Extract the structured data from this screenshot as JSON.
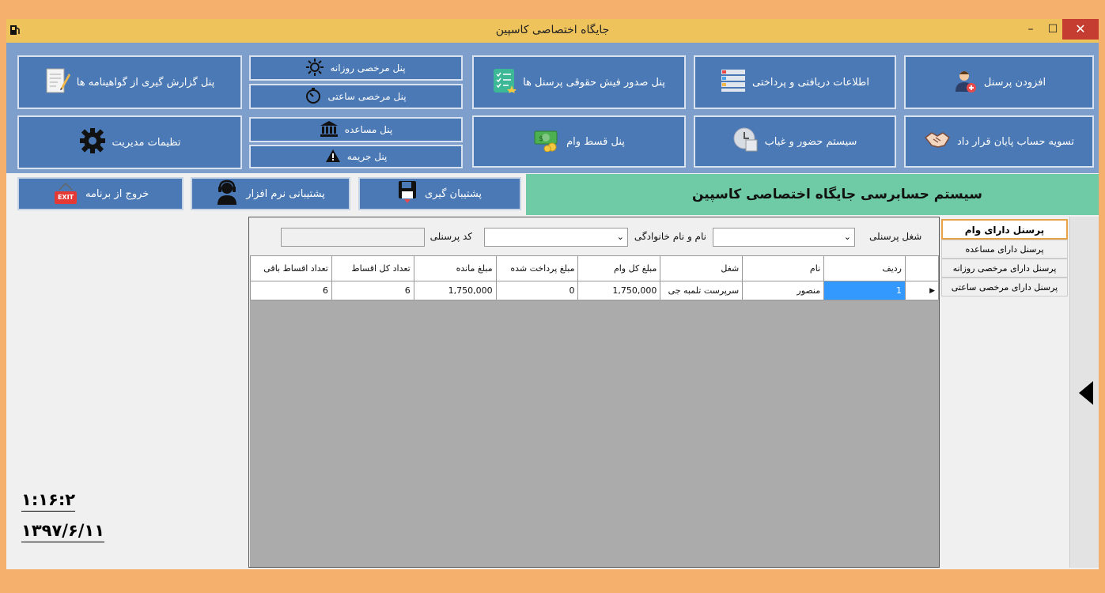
{
  "window": {
    "title": "جایگاه اختصاصی کاسپین",
    "minimize": "–",
    "maximize": "☐",
    "close": "✕"
  },
  "tiles": {
    "add_personnel": "افزودن پرسنل",
    "payments_info": "اطلاعات دریافتی و پرداختی",
    "payslip_panel": "پنل صدور فیش حقوقی پرسنل ها",
    "daily_leave": "پنل مرخصی روزانه",
    "hourly_leave": "پنل مرخصی ساعتی",
    "certificate_report": "پنل گزارش گیری از گواهینامه ها",
    "contract_settlement": "تسویه حساب پایان قرار داد",
    "attendance": "سیستم حضور و غیاب",
    "loan_installment": "پنل قسط وام",
    "assistance": "پنل مساعده",
    "penalty": "پنل جریمه",
    "admin_settings": "تظیمات مدیریت"
  },
  "banner": {
    "title": "سیستم حسابرسی جایگاه اختصاصی کاسپین"
  },
  "actions": {
    "backup": "پشتیبان گیری",
    "support": "پشتیبانی نرم افزار",
    "exit": "خروج از برنامه",
    "exit_badge": "EXIT"
  },
  "clock": {
    "time": "۱:۱۶:۲",
    "date": "۱۳۹۷/۶/۱۱"
  },
  "filters": {
    "job_label": "شغل پرسنلی",
    "name_label": "نام و نام خانوادگی",
    "code_label": "کد پرسنلی",
    "job_value": "",
    "name_value": "",
    "code_value": ""
  },
  "table": {
    "headers": {
      "row": "ردیف",
      "name": "نام",
      "job": "شغل",
      "total_loan": "مبلغ کل وام",
      "paid": "مبلغ پرداخت شده",
      "remaining": "مبلغ مانده",
      "total_installments": "تعداد کل اقساط",
      "remaining_installments": "تعداد اقساط باقی"
    },
    "rows": [
      {
        "row": "1",
        "name": "منصور",
        "job": "سرپرست تلمبه جی",
        "total_loan": "1,750,000",
        "paid": "0",
        "remaining": "1,750,000",
        "total_installments": "6",
        "remaining_installments": "6"
      }
    ]
  },
  "side_tabs": [
    "پرسنل دارای وام",
    "پرسنل دارای مساعده",
    "پرسنل دارای مرخصی روزانه",
    "پرسنل دارای مرخصی ساعتی"
  ],
  "colors": {
    "tile": "#4a79b5",
    "panel": "#7e9fcb",
    "banner": "#6fcba5",
    "titlebar": "#efc35b",
    "selection": "#3399ff"
  }
}
